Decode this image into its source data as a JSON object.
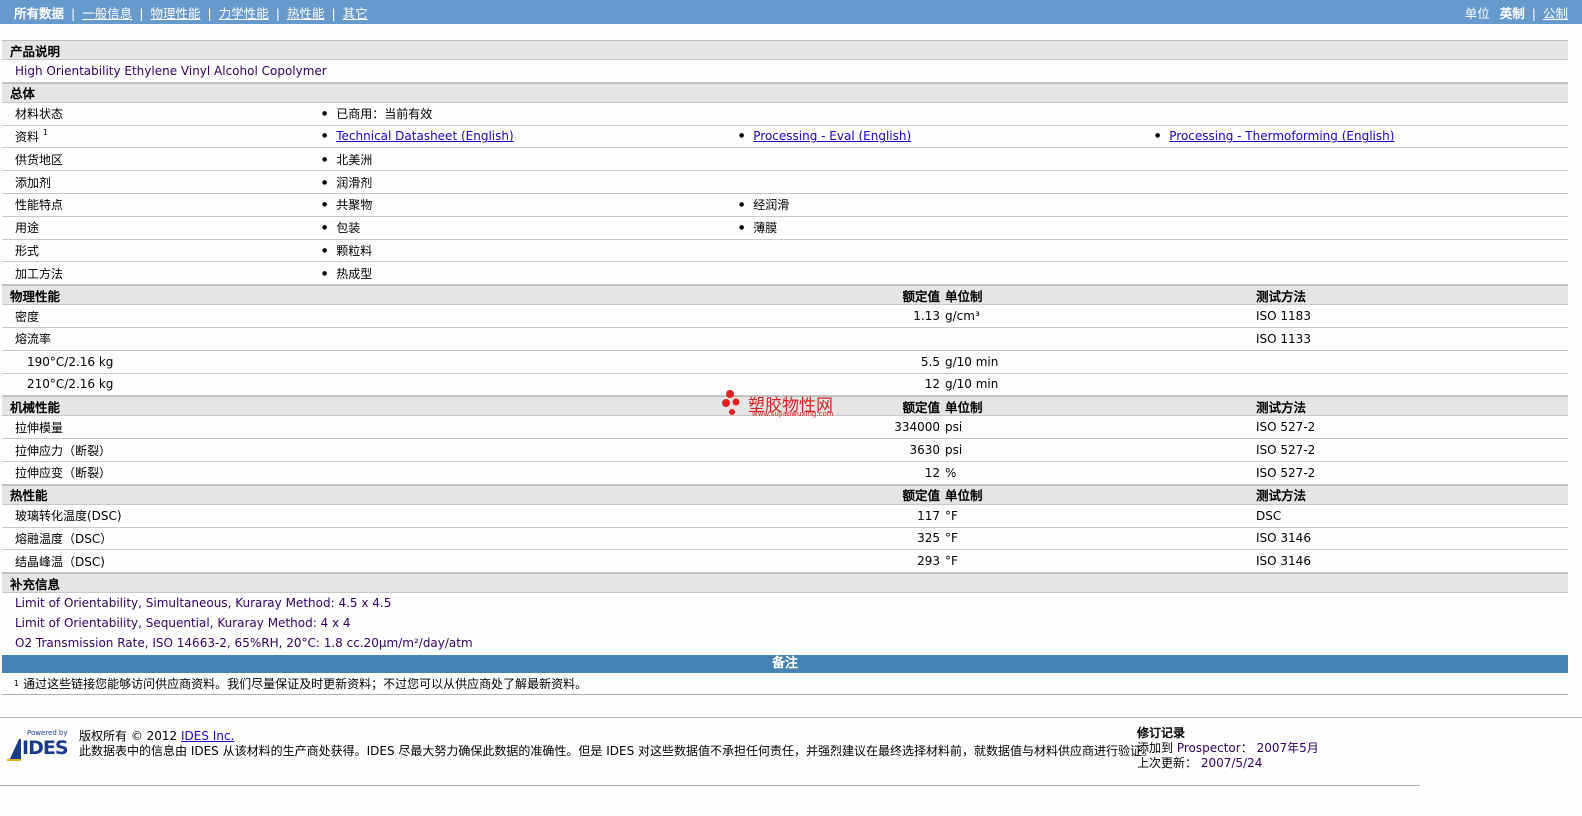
{
  "nav": {
    "active": "所有数据",
    "links": [
      "一般信息",
      "物理性能",
      "力学性能",
      "热性能",
      "其它"
    ],
    "unit_label": "单位",
    "unit_active": "英制",
    "unit_other": "公制"
  },
  "product": {
    "header": "产品说明",
    "description": "High Orientability Ethylene Vinyl Alcohol Copolymer"
  },
  "general": {
    "header": "总体",
    "rows": [
      {
        "label": "材料状态",
        "items": [
          "已商用：当前有效"
        ]
      },
      {
        "label": "资料",
        "sup": "1",
        "links": [
          "Technical Datasheet (English)",
          "Processing - Eval (English)",
          "Processing - Thermoforming (English)"
        ]
      },
      {
        "label": "供货地区",
        "items": [
          "北美洲"
        ]
      },
      {
        "label": "添加剂",
        "items": [
          "润滑剂"
        ]
      },
      {
        "label": "性能特点",
        "items": [
          "共聚物",
          "经润滑"
        ]
      },
      {
        "label": "用途",
        "items": [
          "包装",
          "薄膜"
        ]
      },
      {
        "label": "形式",
        "items": [
          "颗粒料"
        ]
      },
      {
        "label": "加工方法",
        "items": [
          "热成型"
        ]
      }
    ]
  },
  "col_headers": {
    "value": "额定值",
    "unit": "单位制",
    "test": "测试方法"
  },
  "physical": {
    "header": "物理性能",
    "rows": [
      {
        "label": "密度",
        "value": "1.13",
        "unit": "g/cm³",
        "test": "ISO 1183"
      },
      {
        "label": "熔流率",
        "value": "",
        "unit": "",
        "test": "ISO 1133"
      },
      {
        "label": "190°C/2.16 kg",
        "value": "5.5",
        "unit": "g/10 min",
        "test": "",
        "sub": true
      },
      {
        "label": "210°C/2.16 kg",
        "value": "12",
        "unit": "g/10 min",
        "test": "",
        "sub": true
      }
    ]
  },
  "mechanical": {
    "header": "机械性能",
    "rows": [
      {
        "label": "拉伸模量",
        "value": "334000",
        "unit": "psi",
        "test": "ISO 527-2"
      },
      {
        "label": "拉伸应力（断裂）",
        "value": "3630",
        "unit": "psi",
        "test": "ISO 527-2"
      },
      {
        "label": "拉伸应变（断裂）",
        "value": "12",
        "unit": "%",
        "test": "ISO 527-2"
      }
    ]
  },
  "thermal": {
    "header": "热性能",
    "rows": [
      {
        "label": "玻璃转化温度(DSC)",
        "value": "117",
        "unit": "°F",
        "test": "DSC"
      },
      {
        "label": "熔融温度（DSC）",
        "value": "325",
        "unit": "°F",
        "test": "ISO 3146"
      },
      {
        "label": "结晶峰温（DSC)",
        "value": "293",
        "unit": "°F",
        "test": "ISO 3146"
      }
    ]
  },
  "supplement": {
    "header": "补充信息",
    "notes": [
      "Limit of Orientability, Simultaneous, Kuraray Method: 4.5 x 4.5",
      "Limit of Orientability, Sequential, Kuraray Method: 4 x 4",
      "O2 Transmission Rate, ISO 14663-2, 65%RH, 20°C: 1.8 cc.20µm/m²/day/atm"
    ]
  },
  "remarks": {
    "header": "备注",
    "footnote_mark": "1",
    "footnote": "通过这些链接您能够访问供应商资料。我们尽量保证及时更新资料；不过您可以从供应商处了解最新资料。"
  },
  "footer": {
    "logo_powered": "Powered by",
    "logo_name": "IDES",
    "copyright": "版权所有 © 2012",
    "company_link": "IDES Inc.",
    "disclaimer": "此数据表中的信息由 IDES 从该材料的生产商处获得。IDES 尽最大努力确保此数据的准确性。但是 IDES 对这些数据值不承担任何责任，并强烈建议在最终选择材料前，就数据值与材料供应商进行验证。",
    "revision_title": "修订记录",
    "added_label": "添加到",
    "added_app": "Prospector",
    "added_sep": "：",
    "added_date": "2007年5月",
    "updated_label": "上次更新：",
    "updated_date": "2007/5/24"
  },
  "watermark": {
    "name": "塑胶物性网",
    "url": "www.sujiaowuxing.com"
  }
}
